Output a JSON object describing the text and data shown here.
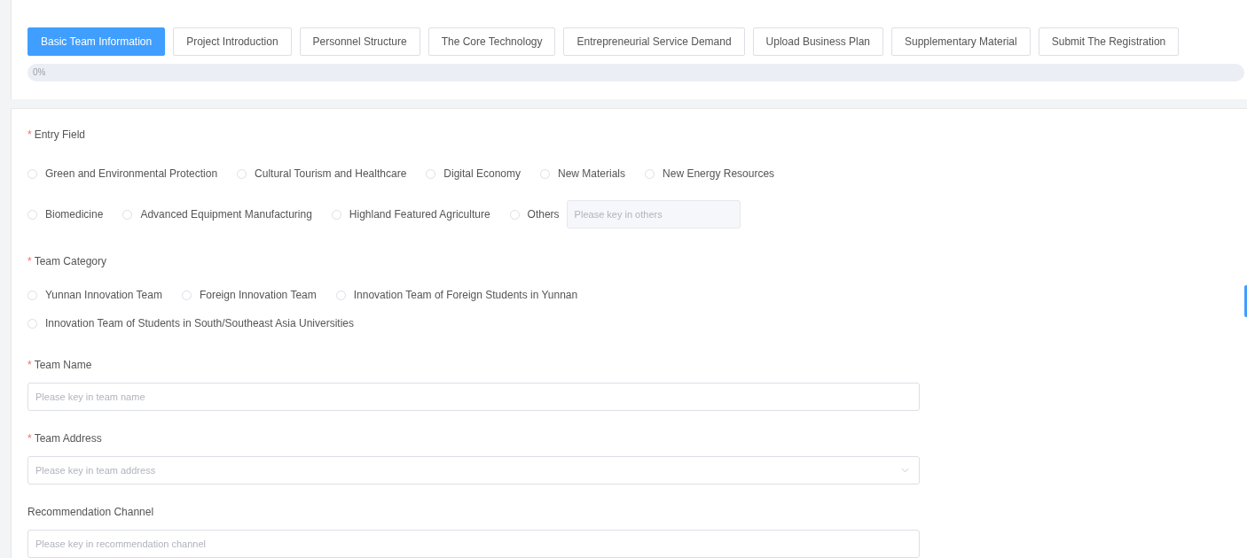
{
  "tabs": [
    {
      "label": "Basic Team Information",
      "selected": true
    },
    {
      "label": "Project Introduction",
      "selected": false
    },
    {
      "label": "Personnel Structure",
      "selected": false
    },
    {
      "label": "The Core Technology",
      "selected": false
    },
    {
      "label": "Entrepreneurial Service Demand",
      "selected": false
    },
    {
      "label": "Upload Business Plan",
      "selected": false
    },
    {
      "label": "Supplementary Material",
      "selected": false
    },
    {
      "label": "Submit The Registration",
      "selected": false
    }
  ],
  "progress": {
    "level": 0,
    "reading": "0%"
  },
  "entry_field": {
    "label": "Entry Field",
    "required_mark": "*",
    "rows": [
      [
        {
          "label": "Green and Environmental Protection",
          "selected": false
        },
        {
          "label": "Cultural Tourism and Healthcare",
          "selected": false
        },
        {
          "label": "Digital Economy",
          "selected": false
        },
        {
          "label": "New Materials",
          "selected": false
        },
        {
          "label": "New Energy Resources",
          "selected": false
        }
      ],
      [
        {
          "label": "Biomedicine",
          "selected": false
        },
        {
          "label": "Advanced Equipment Manufacturing",
          "selected": false
        },
        {
          "label": "Highland Featured Agriculture",
          "selected": false
        },
        {
          "label": "Others",
          "selected": false,
          "input": {
            "placeholder": "Please key in others",
            "disabled": true
          }
        }
      ]
    ]
  },
  "team_category": {
    "label": "Team Category",
    "required_mark": "*",
    "rows": [
      [
        {
          "label": "Yunnan Innovation Team",
          "selected": false
        },
        {
          "label": "Foreign Innovation Team",
          "selected": false
        },
        {
          "label": "Innovation Team of Foreign Students in Yunnan",
          "selected": false
        }
      ],
      [
        {
          "label": "Innovation Team of Students in South/Southeast Asia Universities",
          "selected": false
        }
      ]
    ]
  },
  "fields": [
    {
      "label": "Team Name",
      "required_mark": "*",
      "kind": "text",
      "placeholder": "Please key in team name"
    },
    {
      "label": "Team Address",
      "required_mark": "*",
      "kind": "select",
      "placeholder": "Please key in team address"
    },
    {
      "label": "Recommendation Channel",
      "kind": "text",
      "placeholder": "Please key in recommendation channel"
    }
  ]
}
